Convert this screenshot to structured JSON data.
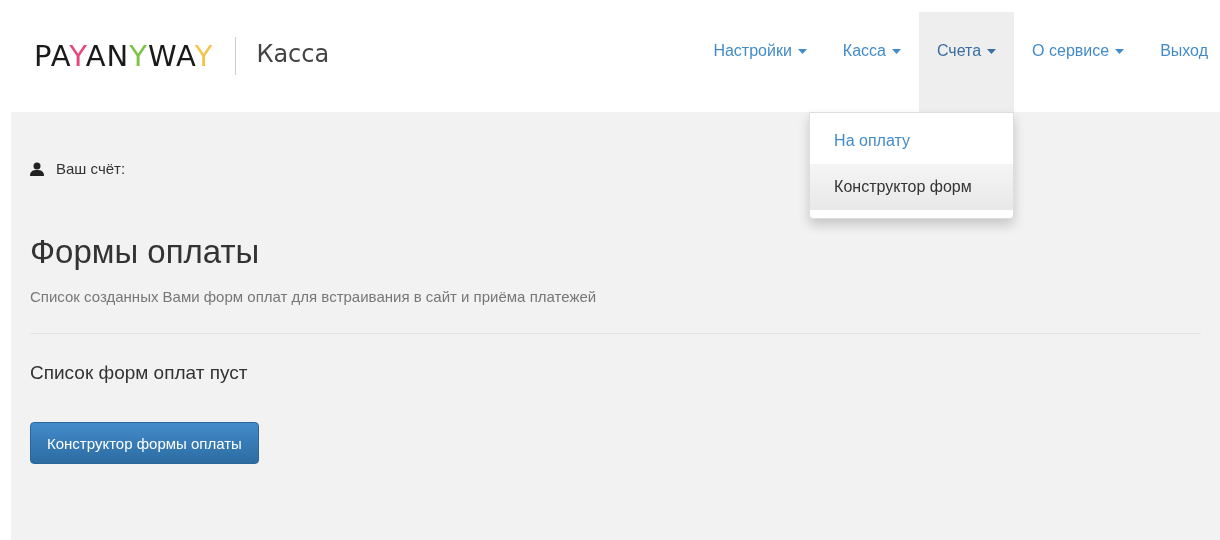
{
  "logo": {
    "letters": [
      {
        "text": "PA",
        "color": "#1a1a1a"
      },
      {
        "text": "Y",
        "color": "#e8457e"
      },
      {
        "text": "AN",
        "color": "#1a1a1a"
      },
      {
        "text": "Y",
        "color": "#7cc243"
      },
      {
        "text": "WA",
        "color": "#1a1a1a"
      },
      {
        "text": "Y",
        "color": "#f2c54a"
      }
    ],
    "subtitle": "Касса"
  },
  "nav": [
    {
      "label": "Настройки",
      "dropdown": true,
      "selected": false
    },
    {
      "label": "Касса",
      "dropdown": true,
      "selected": false
    },
    {
      "label": "Счета",
      "dropdown": true,
      "selected": true,
      "menu": [
        {
          "label": "На оплату",
          "selected": false
        },
        {
          "label": "Конструктор форм",
          "selected": true
        }
      ]
    },
    {
      "label": "О сервисе",
      "dropdown": true,
      "selected": false
    },
    {
      "label": "Выход",
      "dropdown": false,
      "selected": false
    }
  ],
  "account": {
    "label": "Ваш счёт:"
  },
  "title": "Формы оплаты",
  "description": "Список созданных Вами форм оплат для встраивания в сайт и приёма платежей",
  "empty_message": "Список форм оплат пуст",
  "button": "Конструктор формы оплаты"
}
